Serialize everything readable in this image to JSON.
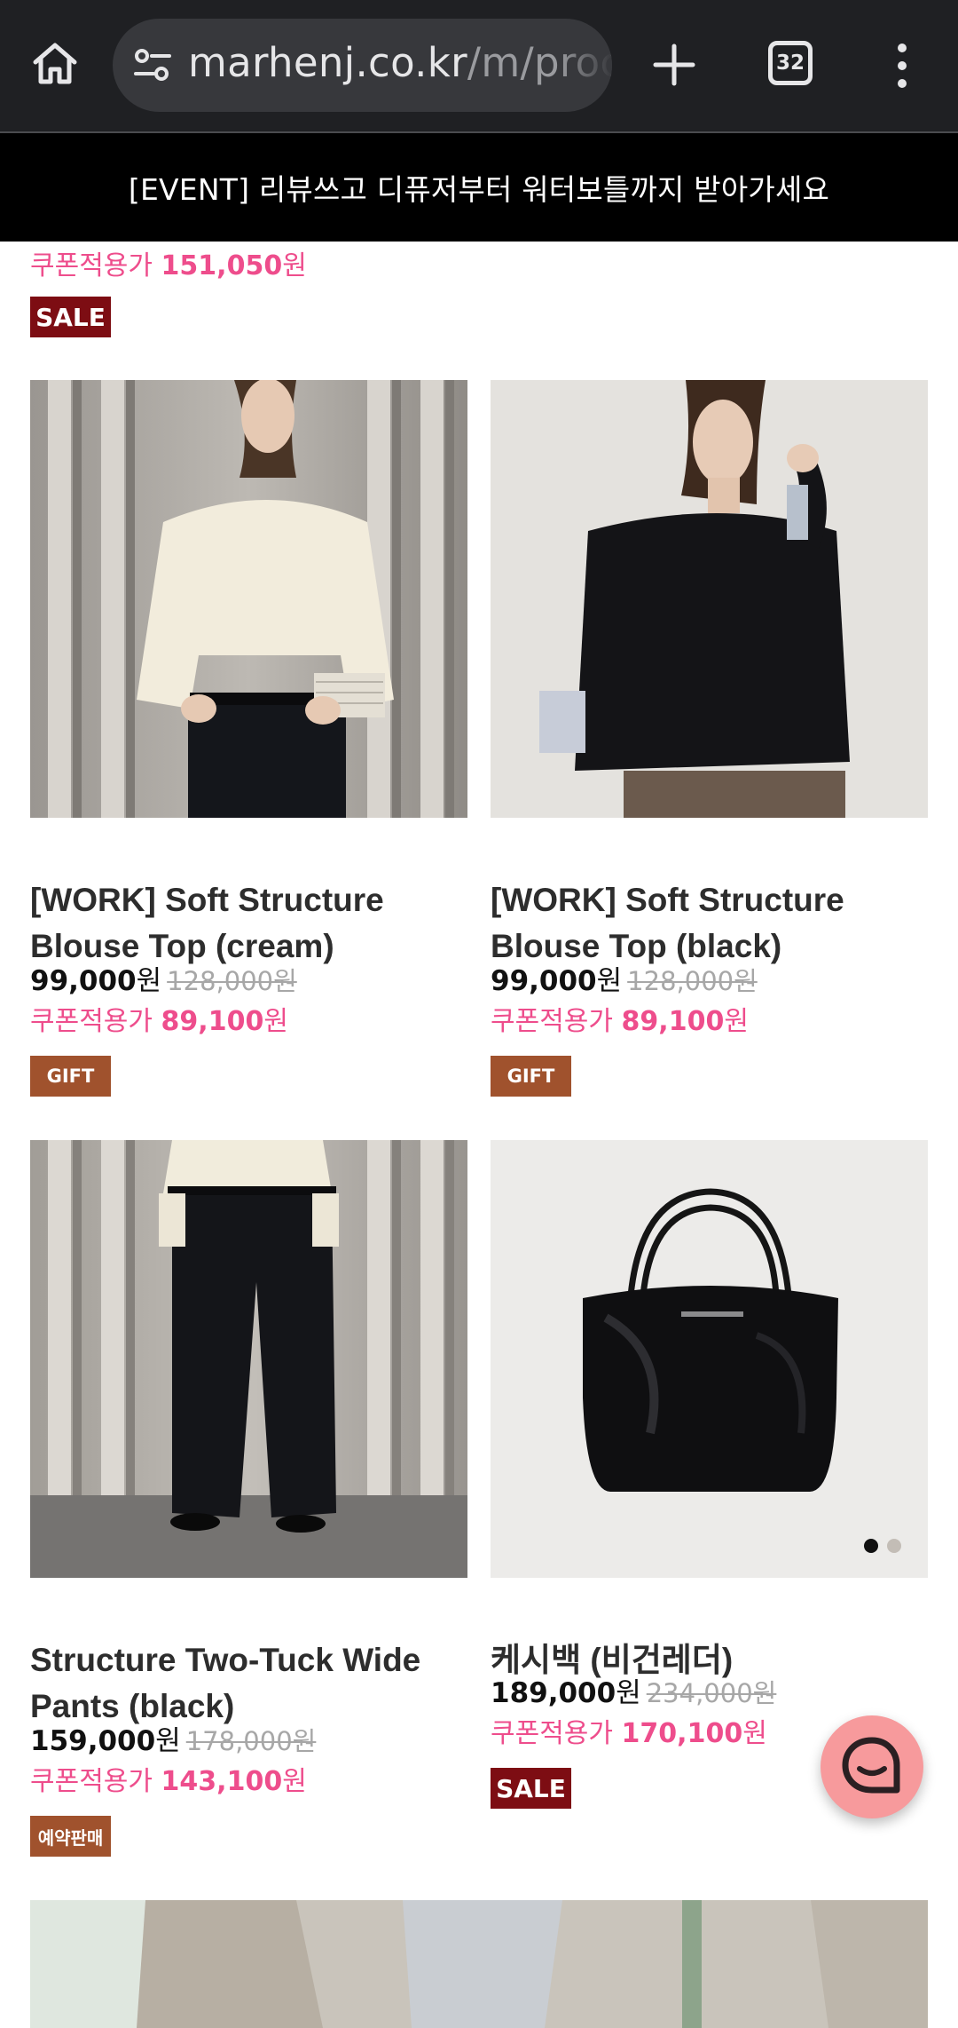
{
  "browser": {
    "url_host": "marhenj.co.kr",
    "url_path": "/m/proc",
    "tab_count": "32"
  },
  "event_banner": "[EVENT] 리뷰쓰고 디퓨저부터 워터보틀까지 받아가세요",
  "top_item": {
    "coupon_label": "쿠폰적용가",
    "coupon_price": "151,050",
    "currency": "원",
    "badge": "SALE"
  },
  "products": [
    {
      "name": "[WORK] Soft Structure Blouse Top (cream)",
      "price": "99,000",
      "currency": "원",
      "original_price": "128,000원",
      "coupon_label": "쿠폰적용가",
      "coupon_price": "89,100",
      "badge": "GIFT"
    },
    {
      "name": "[WORK] Soft Structure Blouse Top (black)",
      "price": "99,000",
      "currency": "원",
      "original_price": "128,000원",
      "coupon_label": "쿠폰적용가",
      "coupon_price": "89,100",
      "badge": "GIFT"
    },
    {
      "name": "Structure Two-Tuck Wide Pants (black)",
      "price": "159,000",
      "currency": "원",
      "original_price": "178,000원",
      "coupon_label": "쿠폰적용가",
      "coupon_price": "143,100",
      "badge": "예약판매"
    },
    {
      "name": "케시백 (비건레더)",
      "price": "189,000",
      "currency": "원",
      "original_price": "234,000원",
      "coupon_label": "쿠폰적용가",
      "coupon_price": "170,100",
      "badge": "SALE"
    }
  ],
  "icons": {
    "home": "home-icon",
    "site_info": "tune-icon",
    "new_tab": "plus-icon",
    "tabs": "tab-switcher-icon",
    "menu": "more-vert-icon",
    "chat": "chat-icon"
  },
  "colors": {
    "coupon": "#ee4d8c",
    "sale_badge": "#7d0d13",
    "gift_badge": "#a0522d",
    "chat_fab": "#f79a9c"
  }
}
